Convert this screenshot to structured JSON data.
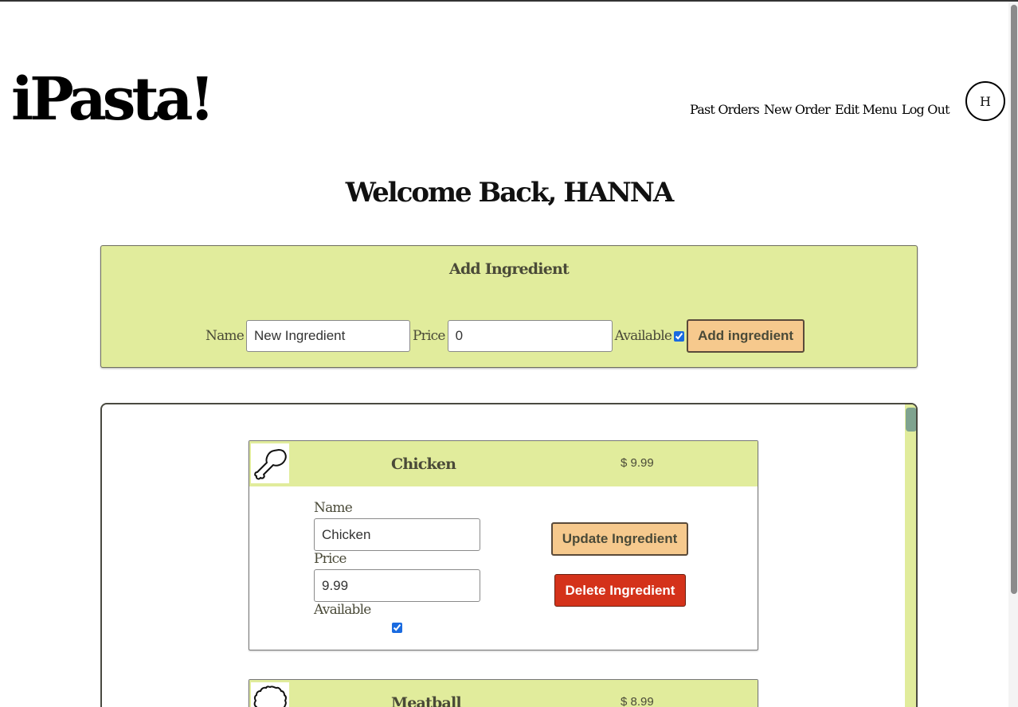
{
  "app": {
    "logo": "iPasta!"
  },
  "nav": {
    "past_orders": "Past Orders",
    "new_order": "New Order",
    "edit_menu": "Edit Menu",
    "log_out": "Log Out"
  },
  "user": {
    "avatar_initial": "H"
  },
  "welcome": "Welcome Back, HANNA",
  "add_form": {
    "title": "Add Ingredient",
    "name_label": "Name",
    "name_value": "New Ingredient",
    "price_label": "Price",
    "price_value": "0",
    "available_label": "Available",
    "available_checked": true,
    "submit_label": "Add ingredient"
  },
  "ingredients": [
    {
      "name": "Chicken",
      "price": "$ 9.99",
      "icon": "chicken-drumstick-icon",
      "form": {
        "name_label": "Name",
        "name_value": "Chicken",
        "price_label": "Price",
        "price_value": "9.99",
        "available_label": "Available",
        "available_checked": true,
        "update_label": "Update Ingredient",
        "delete_label": "Delete Ingredient"
      }
    },
    {
      "name": "Meatball",
      "price": "$ 8.99",
      "icon": "meatball-icon"
    }
  ],
  "colors": {
    "panel": "#e1ec9c",
    "button_orange": "#f6c98d",
    "button_red": "#d4321a",
    "scroll_thumb": "#7fa38f"
  }
}
